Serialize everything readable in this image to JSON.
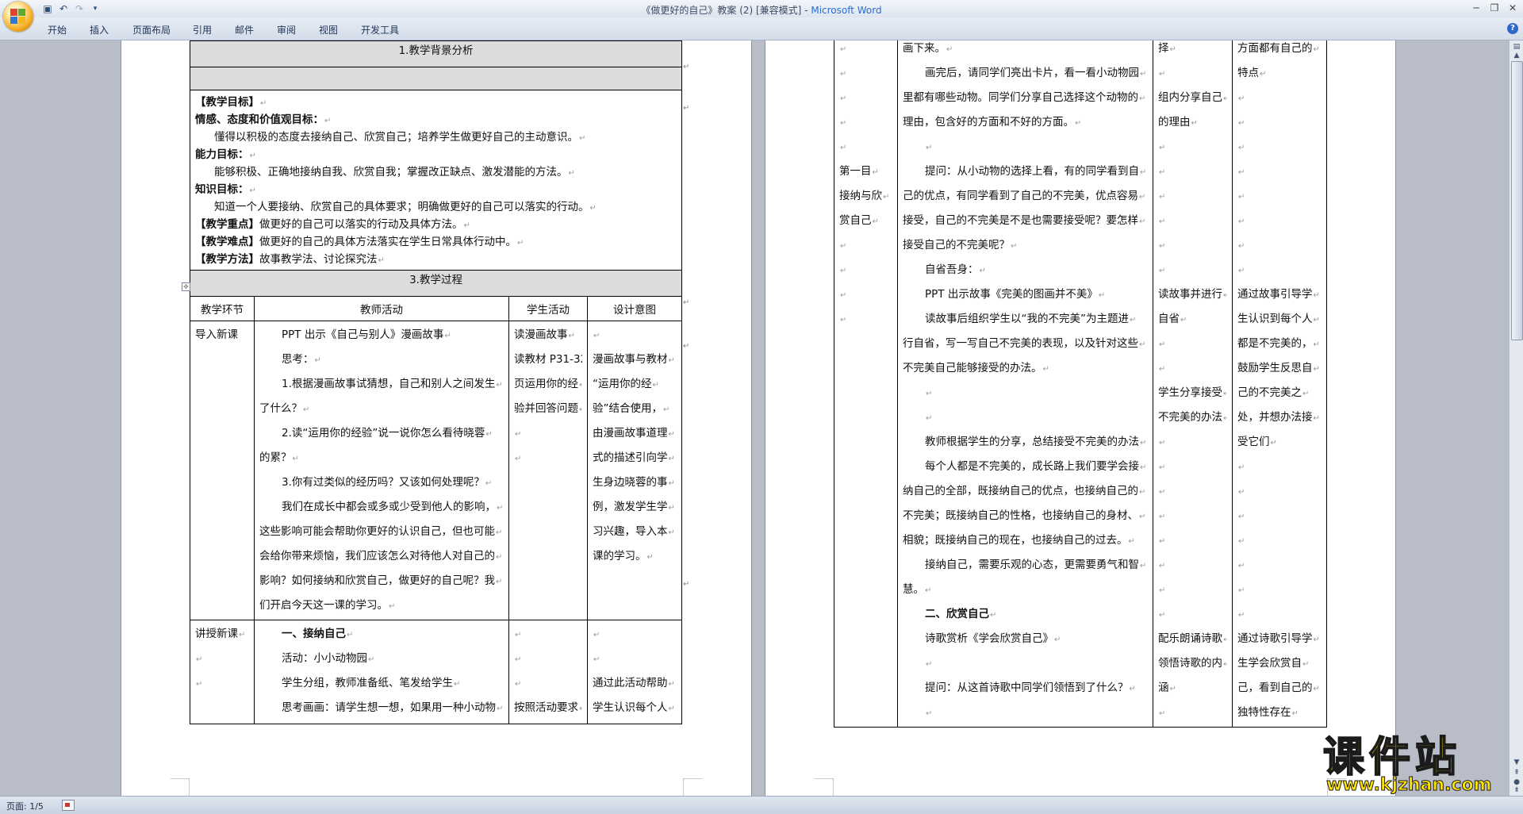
{
  "window": {
    "title_doc": "《做更好的自己》教案 (2) [兼容模式]",
    "title_sep": " - ",
    "title_app": "Microsoft Word"
  },
  "ribbon": {
    "tabs": [
      "开始",
      "插入",
      "页面布局",
      "引用",
      "邮件",
      "审阅",
      "视图",
      "开发工具"
    ]
  },
  "status": {
    "page": "页面: 1/5"
  },
  "watermark": {
    "cn": "课件站",
    "url": "www.kjzhan.com"
  },
  "page1": {
    "section1_header": "1.教学背景分析",
    "goals": [
      {
        "bold": "【教学目标】",
        "text": ""
      },
      {
        "bold": "情感、态度和价值观目标：",
        "text": ""
      },
      {
        "bold": "",
        "text": "懂得以积极的态度去接纳自己、欣赏自己；培养学生做更好自己的主动意识。",
        "indent": true
      },
      {
        "bold": "能力目标：",
        "text": ""
      },
      {
        "bold": "",
        "text": "能够积极、正确地接纳自我、欣赏自我；掌握改正缺点、激发潜能的方法。",
        "indent": true
      },
      {
        "bold": "知识目标：",
        "text": ""
      },
      {
        "bold": "",
        "text": "知道一个人要接纳、欣赏自己的具体要求；明确做更好的自己可以落实的行动。",
        "indent": true
      },
      {
        "bold": "【教学重点】",
        "text": "做更好的自己可以落实的行动及具体方法。"
      },
      {
        "bold": "【教学难点】",
        "text": "做更好的自己的具体方法落实在学生日常具体行动中。"
      },
      {
        "bold": "【教学方法】",
        "text": "故事教学法、讨论探究法"
      }
    ],
    "section3_header": "3.教学过程",
    "columns": [
      "教学环节",
      "教师活动",
      "学生活动",
      "设计意图"
    ],
    "row1": {
      "stage": "导入新课",
      "teacher": [
        {
          "t": "PPT 出示《自己与别人》漫画故事",
          "i": true
        },
        {
          "t": "思考：",
          "i": true
        },
        {
          "t": "1.根据漫画故事试猜想，自己和别人之间发生",
          "i": true
        },
        {
          "t": "了什么？",
          "i": false
        },
        {
          "t": "2.读“运用你的经验”说一说你怎么看待晓蓉",
          "i": true
        },
        {
          "t": "的累？",
          "i": false
        },
        {
          "t": "3.你有过类似的经历吗？又该如何处理呢？",
          "i": true
        },
        {
          "t": "我们在成长中都会或多或少受到他人的影响，",
          "i": true
        },
        {
          "t": "这些影响可能会帮助你更好的认识自己，但也可能",
          "i": false
        },
        {
          "t": "会给你带来烦恼，我们应该怎么对待他人对自己的",
          "i": false
        },
        {
          "t": "影响？如何接纳和欣赏自己，做更好的自己呢？我",
          "i": false
        },
        {
          "t": "们开启今天这一课的学习。",
          "i": false
        }
      ],
      "student": [
        "读漫画故事",
        "读教材 P31-32",
        "页运用你的经",
        "验并回答问题",
        "",
        ""
      ],
      "design": [
        "",
        "漫画故事与教材",
        "“运用你的经",
        "验”结合使用，",
        "由漫画故事道理",
        "式的描述引向学",
        "生身边晓蓉的事",
        "例，激发学生学",
        "习兴趣，导入本",
        "课的学习。"
      ]
    },
    "row2": {
      "stage": [
        "讲授新课",
        "",
        ""
      ],
      "teacher": [
        {
          "t": "一、接纳自己",
          "i": true,
          "b": true
        },
        {
          "t": "活动：小小动物园",
          "i": true
        },
        {
          "t": "学生分组，教师准备纸、笔发给学生",
          "i": true
        },
        {
          "t": "思考画画：请学生想一想，如果用一种小动物",
          "i": true
        }
      ],
      "student": [
        "",
        "",
        "",
        "按照活动要求"
      ],
      "design": [
        "",
        "",
        "通过此活动帮助",
        "学生认识每个人"
      ]
    }
  },
  "page2": {
    "stage": [
      "",
      "",
      "",
      "",
      "",
      "第一目",
      "接纳与欣",
      "赏自己",
      "",
      "",
      "",
      ""
    ],
    "teacher": [
      {
        "t": "画下来。",
        "i": false
      },
      {
        "t": "画完后，请同学们亮出卡片，看一看小动物园",
        "i": true
      },
      {
        "t": "里都有哪些动物。同学们分享自己选择这个动物的",
        "i": false
      },
      {
        "t": "理由，包含好的方面和不好的方面。",
        "i": false
      },
      {
        "t": "",
        "i": true
      },
      {
        "t": "提问：从小动物的选择上看，有的同学看到自",
        "i": true
      },
      {
        "t": "己的优点，有同学看到了自己的不完美，优点容易",
        "i": false
      },
      {
        "t": "接受，自己的不完美是不是也需要接受呢？要怎样",
        "i": false
      },
      {
        "t": "接受自己的不完美呢？",
        "i": false
      },
      {
        "t": "自省吾身：",
        "i": true
      },
      {
        "t": "PPT 出示故事《完美的图画并不美》",
        "i": true
      },
      {
        "t": "读故事后组织学生以“我的不完美”为主题进",
        "i": true
      },
      {
        "t": "行自省，写一写自己不完美的表现，以及针对这些",
        "i": false
      },
      {
        "t": "不完美自己能够接受的办法。",
        "i": false
      },
      {
        "t": "",
        "i": true
      },
      {
        "t": "",
        "i": true
      },
      {
        "t": "教师根据学生的分享，总结接受不完美的办法",
        "i": true
      },
      {
        "t": "每个人都是不完美的，成长路上我们要学会接",
        "i": true
      },
      {
        "t": "纳自己的全部，既接纳自己的优点，也接纳自己的",
        "i": false
      },
      {
        "t": "不完美；既接纳自己的性格，也接纳自己的身材、",
        "i": false
      },
      {
        "t": "相貌；既接纳自己的现在，也接纳自己的过去。",
        "i": false
      },
      {
        "t": "接纳自己，需要乐观的心态，更需要勇气和智",
        "i": true
      },
      {
        "t": "慧。",
        "i": false
      },
      {
        "t": "二、欣赏自己",
        "i": true,
        "b": true
      },
      {
        "t": "诗歌赏析《学会欣赏自己》",
        "i": true
      },
      {
        "t": "",
        "i": true
      },
      {
        "t": "提问：从这首诗歌中同学们领悟到了什么？",
        "i": true
      },
      {
        "t": "",
        "i": true
      }
    ],
    "student": [
      "择",
      "",
      "组内分享自己",
      "的理由",
      "",
      "",
      "",
      "",
      "",
      "",
      "读故事并进行",
      "自省",
      "",
      "",
      "学生分享接受",
      "不完美的办法",
      "",
      "",
      "",
      "",
      "",
      "",
      "",
      "",
      "配乐朗诵诗歌",
      "领悟诗歌的内",
      "涵",
      ""
    ],
    "design": [
      "方面都有自己的",
      "特点",
      "",
      "",
      "",
      "",
      "",
      "",
      "",
      "",
      "通过故事引导学",
      "生认识到每个人",
      "都是不完美的，",
      "鼓励学生反思自",
      "己的不完美之",
      "处，并想办法接",
      "受它们",
      "",
      "",
      "",
      "",
      "",
      "",
      "",
      "通过诗歌引导学",
      "生学会欣赏自",
      "己，看到自己的",
      "独特性存在"
    ]
  }
}
